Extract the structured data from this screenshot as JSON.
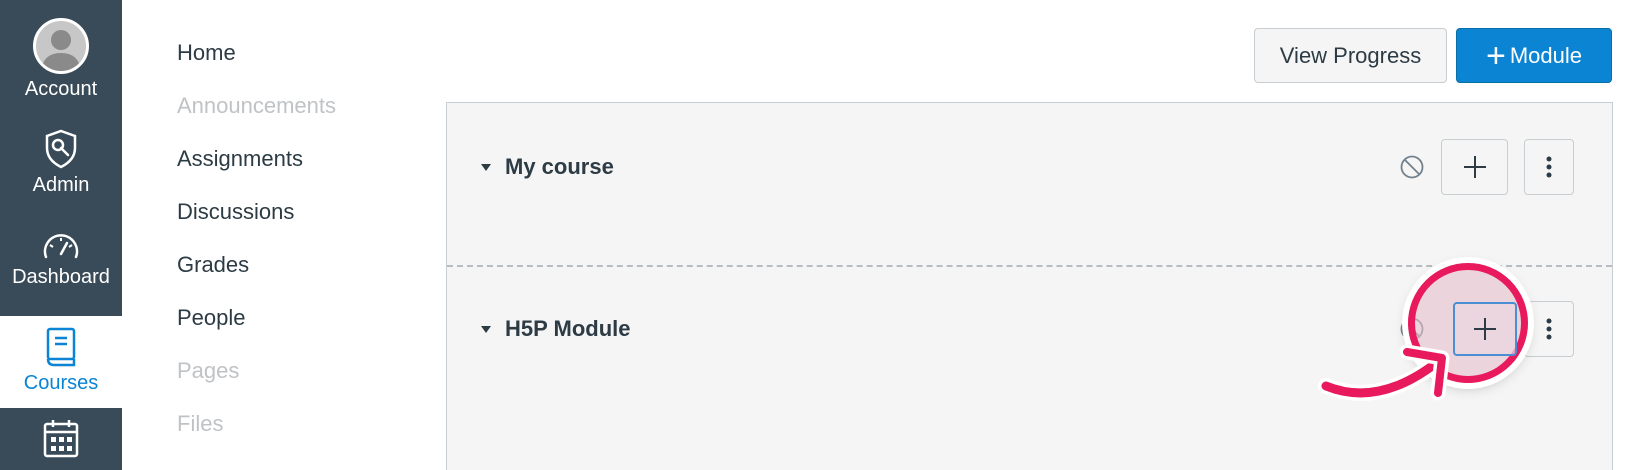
{
  "global_nav": {
    "items": [
      {
        "label": "Account",
        "icon": "avatar"
      },
      {
        "label": "Admin",
        "icon": "shield-wrench-icon"
      },
      {
        "label": "Dashboard",
        "icon": "speedometer-icon"
      },
      {
        "label": "Courses",
        "icon": "book-icon",
        "active": true
      },
      {
        "label": "",
        "icon": "calendar-icon"
      }
    ],
    "colors": {
      "background": "#394b58",
      "active_text": "#0b84d4"
    }
  },
  "course_nav": {
    "items": [
      {
        "label": "Home",
        "enabled": true
      },
      {
        "label": "Announcements",
        "enabled": false
      },
      {
        "label": "Assignments",
        "enabled": true
      },
      {
        "label": "Discussions",
        "enabled": true
      },
      {
        "label": "Grades",
        "enabled": true
      },
      {
        "label": "People",
        "enabled": true
      },
      {
        "label": "Pages",
        "enabled": false
      },
      {
        "label": "Files",
        "enabled": false
      }
    ]
  },
  "header": {
    "view_progress_label": "View Progress",
    "add_module_label": "Module",
    "add_module_icon": "plus-icon"
  },
  "modules": [
    {
      "title": "My course"
    },
    {
      "title": "H5P Module"
    }
  ],
  "colors": {
    "primary": "#0b84d4",
    "highlight": "#e8195d",
    "module_bg": "#f5f5f5"
  }
}
